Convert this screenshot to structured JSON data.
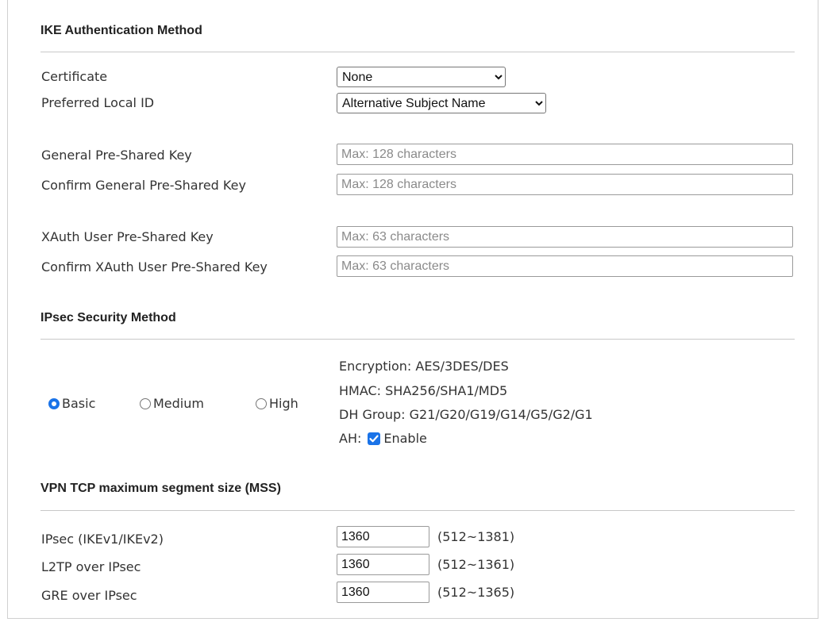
{
  "ike": {
    "heading": "IKE Authentication Method",
    "certificate_label": "Certificate",
    "certificate_value": "None",
    "local_id_label": "Preferred Local ID",
    "local_id_value": "Alternative Subject Name",
    "general_psk_label": "General Pre-Shared Key",
    "general_psk_placeholder": "Max: 128 characters",
    "confirm_general_psk_label": "Confirm General Pre-Shared Key",
    "confirm_general_psk_placeholder": "Max: 128 characters",
    "xauth_psk_label": "XAuth User Pre-Shared Key",
    "xauth_psk_placeholder": "Max: 63 characters",
    "confirm_xauth_psk_label": "Confirm XAuth User Pre-Shared Key",
    "confirm_xauth_psk_placeholder": "Max: 63 characters"
  },
  "ipsec": {
    "heading": "IPsec Security Method",
    "options": [
      {
        "label": "Basic",
        "checked": true
      },
      {
        "label": "Medium",
        "checked": false
      },
      {
        "label": "High",
        "checked": false
      }
    ],
    "encryption": "Encryption: AES/3DES/DES",
    "hmac": "HMAC: SHA256/SHA1/MD5",
    "dh_group": "DH Group: G21/G20/G19/G14/G5/G2/G1",
    "ah_label": "AH:",
    "ah_enable_label": "Enable",
    "ah_enabled": true
  },
  "mss": {
    "heading": "VPN TCP maximum segment size (MSS)",
    "rows": [
      {
        "label": "IPsec (IKEv1/IKEv2)",
        "value": "1360",
        "range": "(512~1381)"
      },
      {
        "label": "L2TP over IPsec",
        "value": "1360",
        "range": "(512~1361)"
      },
      {
        "label": "GRE over IPsec",
        "value": "1360",
        "range": "(512~1365)"
      }
    ]
  },
  "colors": {
    "accent": "#1a73e8",
    "rule": "#c8c8c8"
  }
}
